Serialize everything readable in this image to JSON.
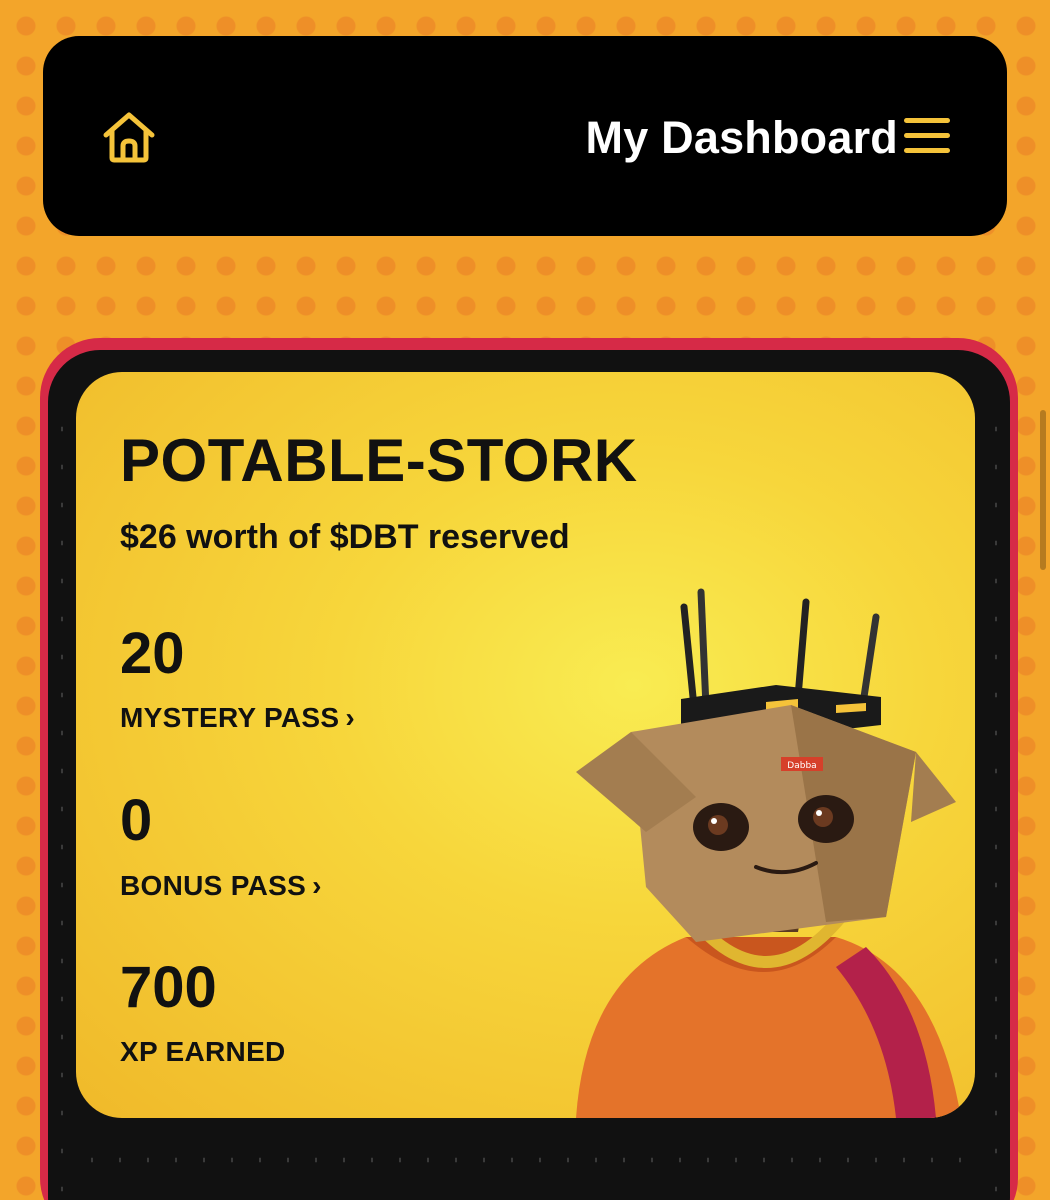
{
  "header": {
    "title": "My Dashboard",
    "home_icon": "home-icon",
    "menu_icon": "hamburger-menu-icon"
  },
  "profile": {
    "name": "POTABLE-STORK",
    "reserved_text": "$26 worth of $DBT reserved",
    "stats": [
      {
        "value": "20",
        "label": "MYSTERY PASS",
        "has_chevron": true
      },
      {
        "value": "0",
        "label": "BONUS PASS",
        "has_chevron": true
      },
      {
        "value": "700",
        "label": "XP EARNED",
        "has_chevron": false
      }
    ],
    "chevron": "›",
    "avatar_badge": "Dabba"
  },
  "colors": {
    "background": "#f3a52a",
    "header_bg": "#000000",
    "accent_yellow": "#f5c33a",
    "card_border": "#d62a47",
    "card_yellow": "#f7d63b"
  }
}
